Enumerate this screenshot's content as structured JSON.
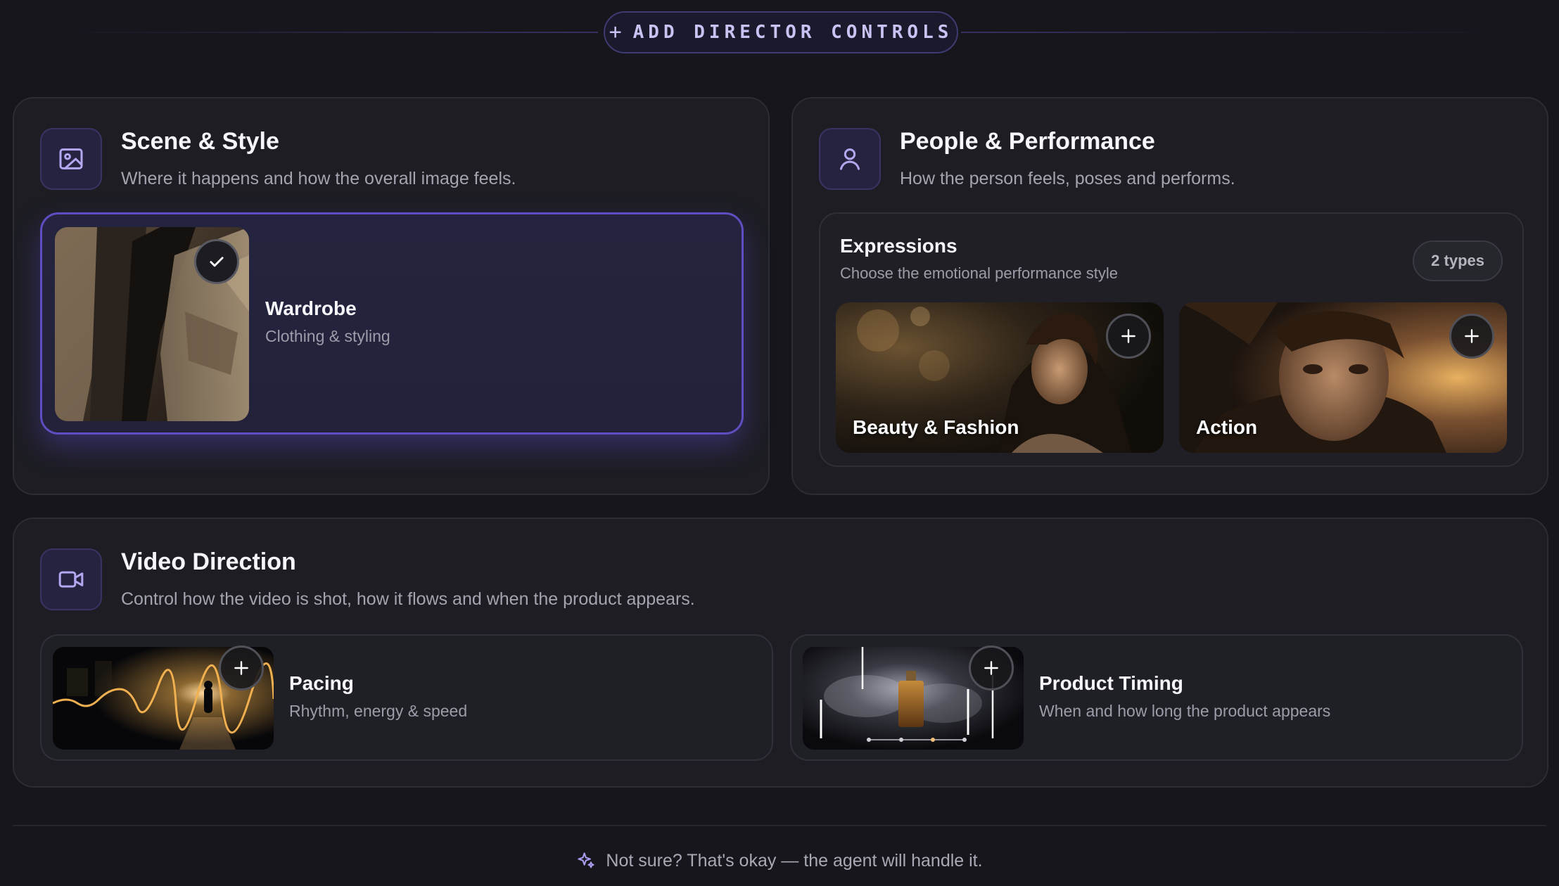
{
  "header": {
    "add_button_plus": "+",
    "add_button_label": "ADD DIRECTOR CONTROLS"
  },
  "scene_style": {
    "icon": "image-icon",
    "title": "Scene & Style",
    "subtitle": "Where it happens and how the overall image feels.",
    "cards": [
      {
        "title": "Wardrobe",
        "subtitle": "Clothing & styling",
        "selected": true
      }
    ]
  },
  "people_performance": {
    "icon": "person-icon",
    "title": "People & Performance",
    "subtitle": "How the person feels, poses and performs.",
    "expressions": {
      "title": "Expressions",
      "subtitle": "Choose the emotional performance style",
      "count_badge": "2 types",
      "items": [
        {
          "label": "Beauty & Fashion"
        },
        {
          "label": "Action"
        }
      ]
    }
  },
  "video_direction": {
    "icon": "video-camera-icon",
    "title": "Video Direction",
    "subtitle": "Control how the video is shot, how it flows and when the product appears.",
    "cards": [
      {
        "title": "Pacing",
        "subtitle": "Rhythm, energy & speed"
      },
      {
        "title": "Product Timing",
        "subtitle": "When and how long the product appears"
      }
    ]
  },
  "footer": {
    "icon": "sparkle-icon",
    "text": "Not sure? That's okay — the agent will handle it."
  },
  "colors": {
    "background": "#16161c",
    "panel": "#1d1d23",
    "accent": "#5d4fc2",
    "accent_text": "#c9c3f4"
  }
}
